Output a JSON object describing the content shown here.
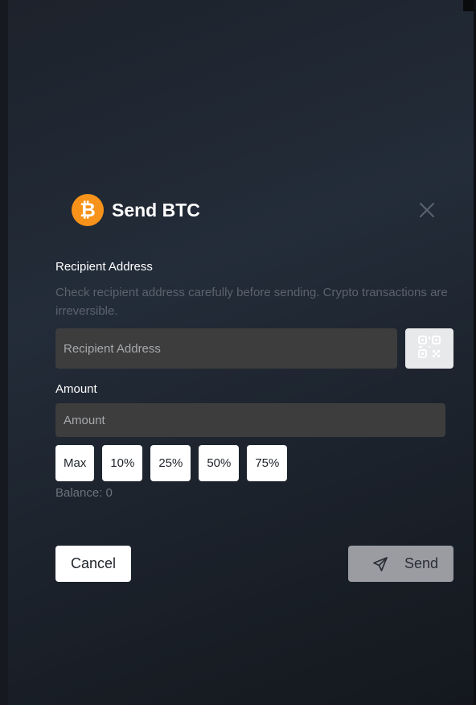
{
  "dialog": {
    "title": "Send BTC",
    "coin_symbol": "₿",
    "accent_color": "#f7931a"
  },
  "recipient": {
    "label": "Recipient Address",
    "hint": "Check recipient address carefully before sending. Crypto transactions are irreversible.",
    "placeholder": "Recipient Address",
    "value": ""
  },
  "amount": {
    "label": "Amount",
    "placeholder": "Amount",
    "value": "",
    "presets": [
      "Max",
      "10%",
      "25%",
      "50%",
      "75%"
    ],
    "balance": "Balance: 0"
  },
  "actions": {
    "cancel_label": "Cancel",
    "send_label": "Send"
  }
}
